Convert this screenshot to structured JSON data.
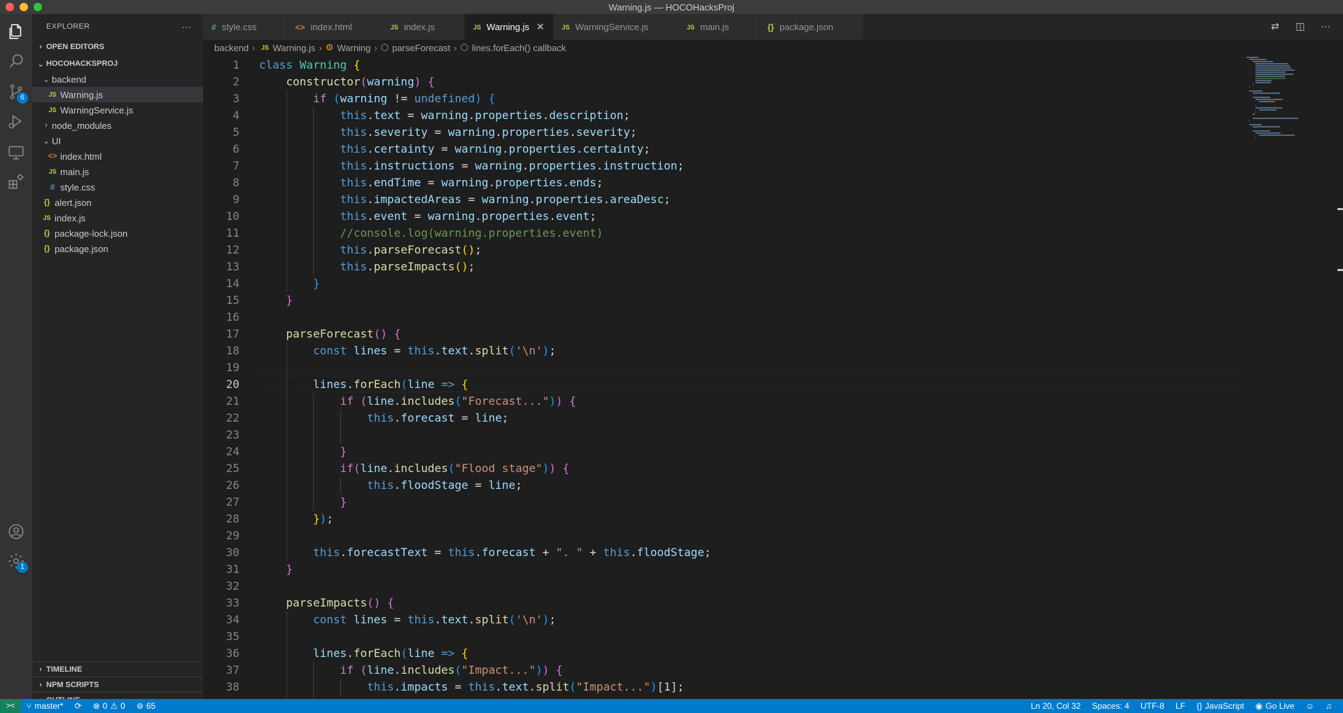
{
  "window": {
    "title": "Warning.js — HOCOHacksProj"
  },
  "colors": {
    "accent": "#007acc",
    "traffic_close": "#ff5f57",
    "traffic_min": "#febc2e",
    "traffic_max": "#28c840"
  },
  "activity": {
    "icons": [
      "files-icon",
      "search-icon",
      "source-control-icon",
      "run-debug-icon",
      "remote-explorer-icon",
      "extensions-icon",
      "account-icon",
      "settings-gear-icon"
    ],
    "scm_badge": "6",
    "settings_badge": "1"
  },
  "sidebar": {
    "title": "EXPLORER",
    "more": "···",
    "open_editors": "OPEN EDITORS",
    "project": "HOCOHACKSPROJ",
    "tree": [
      {
        "label": "backend",
        "type": "folder-open",
        "depth": 1
      },
      {
        "label": "Warning.js",
        "type": "js",
        "depth": 2,
        "selected": true
      },
      {
        "label": "WarningService.js",
        "type": "js",
        "depth": 2
      },
      {
        "label": "node_modules",
        "type": "folder-closed",
        "depth": 1
      },
      {
        "label": "UI",
        "type": "folder-open",
        "depth": 1
      },
      {
        "label": "index.html",
        "type": "html",
        "depth": 2
      },
      {
        "label": "main.js",
        "type": "js",
        "depth": 2
      },
      {
        "label": "style.css",
        "type": "css",
        "depth": 2
      },
      {
        "label": "alert.json",
        "type": "json",
        "depth": 1
      },
      {
        "label": "index.js",
        "type": "js",
        "depth": 1
      },
      {
        "label": "package-lock.json",
        "type": "json",
        "depth": 1
      },
      {
        "label": "package.json",
        "type": "json",
        "depth": 1
      }
    ],
    "timeline": "TIMELINE",
    "npm_scripts": "NPM SCRIPTS",
    "outline": "OUTLINE"
  },
  "tabs": [
    {
      "label": "style.css",
      "icon": "#",
      "type": "css"
    },
    {
      "label": "index.html",
      "icon": "<>",
      "type": "html"
    },
    {
      "label": "index.js",
      "icon": "JS",
      "type": "js"
    },
    {
      "label": "Warning.js",
      "icon": "JS",
      "type": "js",
      "active": true
    },
    {
      "label": "WarningService.js",
      "icon": "JS",
      "type": "js"
    },
    {
      "label": "main.js",
      "icon": "JS",
      "type": "js"
    },
    {
      "label": "package.json",
      "icon": "{}",
      "type": "json"
    }
  ],
  "breadcrumb": {
    "folder": "backend",
    "file": "Warning.js",
    "class": "Warning",
    "method": "parseForecast",
    "callback": "lines.forEach() callback"
  },
  "editor": {
    "current_line": 20,
    "lines": [
      [
        [
          "kw",
          "class"
        ],
        [
          "t",
          " "
        ],
        [
          "cls",
          "Warning"
        ],
        [
          "t",
          " "
        ],
        [
          "br1",
          "{"
        ]
      ],
      [
        [
          "t",
          "    "
        ],
        [
          "fn",
          "constructor"
        ],
        [
          "br2",
          "("
        ],
        [
          "var",
          "warning"
        ],
        [
          "br2",
          ")"
        ],
        [
          "t",
          " "
        ],
        [
          "br2",
          "{"
        ]
      ],
      [
        [
          "t",
          "        "
        ],
        [
          "ctl",
          "if"
        ],
        [
          "t",
          " "
        ],
        [
          "br3",
          "("
        ],
        [
          "var",
          "warning"
        ],
        [
          "t",
          " != "
        ],
        [
          "kw",
          "undefined"
        ],
        [
          "br3",
          ")"
        ],
        [
          "t",
          " "
        ],
        [
          "br3",
          "{"
        ]
      ],
      [
        [
          "t",
          "            "
        ],
        [
          "kw",
          "this"
        ],
        [
          "t",
          "."
        ],
        [
          "var",
          "text"
        ],
        [
          "t",
          " = "
        ],
        [
          "var",
          "warning"
        ],
        [
          "t",
          "."
        ],
        [
          "var",
          "properties"
        ],
        [
          "t",
          "."
        ],
        [
          "var",
          "description"
        ],
        [
          "t",
          ";"
        ]
      ],
      [
        [
          "t",
          "            "
        ],
        [
          "kw",
          "this"
        ],
        [
          "t",
          "."
        ],
        [
          "var",
          "severity"
        ],
        [
          "t",
          " = "
        ],
        [
          "var",
          "warning"
        ],
        [
          "t",
          "."
        ],
        [
          "var",
          "properties"
        ],
        [
          "t",
          "."
        ],
        [
          "var",
          "severity"
        ],
        [
          "t",
          ";"
        ]
      ],
      [
        [
          "t",
          "            "
        ],
        [
          "kw",
          "this"
        ],
        [
          "t",
          "."
        ],
        [
          "var",
          "certainty"
        ],
        [
          "t",
          " = "
        ],
        [
          "var",
          "warning"
        ],
        [
          "t",
          "."
        ],
        [
          "var",
          "properties"
        ],
        [
          "t",
          "."
        ],
        [
          "var",
          "certainty"
        ],
        [
          "t",
          ";"
        ]
      ],
      [
        [
          "t",
          "            "
        ],
        [
          "kw",
          "this"
        ],
        [
          "t",
          "."
        ],
        [
          "var",
          "instructions"
        ],
        [
          "t",
          " = "
        ],
        [
          "var",
          "warning"
        ],
        [
          "t",
          "."
        ],
        [
          "var",
          "properties"
        ],
        [
          "t",
          "."
        ],
        [
          "var",
          "instruction"
        ],
        [
          "t",
          ";"
        ]
      ],
      [
        [
          "t",
          "            "
        ],
        [
          "kw",
          "this"
        ],
        [
          "t",
          "."
        ],
        [
          "var",
          "endTime"
        ],
        [
          "t",
          " = "
        ],
        [
          "var",
          "warning"
        ],
        [
          "t",
          "."
        ],
        [
          "var",
          "properties"
        ],
        [
          "t",
          "."
        ],
        [
          "var",
          "ends"
        ],
        [
          "t",
          ";"
        ]
      ],
      [
        [
          "t",
          "            "
        ],
        [
          "kw",
          "this"
        ],
        [
          "t",
          "."
        ],
        [
          "var",
          "impactedAreas"
        ],
        [
          "t",
          " = "
        ],
        [
          "var",
          "warning"
        ],
        [
          "t",
          "."
        ],
        [
          "var",
          "properties"
        ],
        [
          "t",
          "."
        ],
        [
          "var",
          "areaDesc"
        ],
        [
          "t",
          ";"
        ]
      ],
      [
        [
          "t",
          "            "
        ],
        [
          "kw",
          "this"
        ],
        [
          "t",
          "."
        ],
        [
          "var",
          "event"
        ],
        [
          "t",
          " = "
        ],
        [
          "var",
          "warning"
        ],
        [
          "t",
          "."
        ],
        [
          "var",
          "properties"
        ],
        [
          "t",
          "."
        ],
        [
          "var",
          "event"
        ],
        [
          "t",
          ";"
        ]
      ],
      [
        [
          "t",
          "            "
        ],
        [
          "cmt",
          "//console.log(warning.properties.event)"
        ]
      ],
      [
        [
          "t",
          "            "
        ],
        [
          "kw",
          "this"
        ],
        [
          "t",
          "."
        ],
        [
          "fn",
          "parseForecast"
        ],
        [
          "br1",
          "("
        ],
        [
          "br1",
          ")"
        ],
        [
          "t",
          ";"
        ]
      ],
      [
        [
          "t",
          "            "
        ],
        [
          "kw",
          "this"
        ],
        [
          "t",
          "."
        ],
        [
          "fn",
          "parseImpacts"
        ],
        [
          "br1",
          "("
        ],
        [
          "br1",
          ")"
        ],
        [
          "t",
          ";"
        ]
      ],
      [
        [
          "t",
          "        "
        ],
        [
          "br3",
          "}"
        ]
      ],
      [
        [
          "t",
          "    "
        ],
        [
          "br2",
          "}"
        ]
      ],
      [
        [
          "t",
          ""
        ]
      ],
      [
        [
          "t",
          "    "
        ],
        [
          "fn",
          "parseForecast"
        ],
        [
          "br2",
          "("
        ],
        [
          "br2",
          ")"
        ],
        [
          "t",
          " "
        ],
        [
          "br2",
          "{"
        ]
      ],
      [
        [
          "t",
          "        "
        ],
        [
          "kw",
          "const"
        ],
        [
          "t",
          " "
        ],
        [
          "var",
          "lines"
        ],
        [
          "t",
          " = "
        ],
        [
          "kw",
          "this"
        ],
        [
          "t",
          "."
        ],
        [
          "var",
          "text"
        ],
        [
          "t",
          "."
        ],
        [
          "fn",
          "split"
        ],
        [
          "br3",
          "("
        ],
        [
          "str",
          "'\\n'"
        ],
        [
          "br3",
          ")"
        ],
        [
          "t",
          ";"
        ]
      ],
      [
        [
          "t",
          ""
        ]
      ],
      [
        [
          "t",
          "        "
        ],
        [
          "var",
          "lines"
        ],
        [
          "t",
          "."
        ],
        [
          "fn",
          "forEach"
        ],
        [
          "br3",
          "("
        ],
        [
          "var",
          "line"
        ],
        [
          "t",
          " "
        ],
        [
          "kw",
          "=>"
        ],
        [
          "t",
          " "
        ],
        [
          "br1",
          "{"
        ]
      ],
      [
        [
          "t",
          "            "
        ],
        [
          "ctl",
          "if"
        ],
        [
          "t",
          " "
        ],
        [
          "br2",
          "("
        ],
        [
          "var",
          "line"
        ],
        [
          "t",
          "."
        ],
        [
          "fn",
          "includes"
        ],
        [
          "br3",
          "("
        ],
        [
          "str",
          "\"Forecast...\""
        ],
        [
          "br3",
          ")"
        ],
        [
          "br2",
          ")"
        ],
        [
          "t",
          " "
        ],
        [
          "br2",
          "{"
        ]
      ],
      [
        [
          "t",
          "                "
        ],
        [
          "kw",
          "this"
        ],
        [
          "t",
          "."
        ],
        [
          "var",
          "forecast"
        ],
        [
          "t",
          " = "
        ],
        [
          "var",
          "line"
        ],
        [
          "t",
          ";"
        ]
      ],
      [
        [
          "t",
          ""
        ]
      ],
      [
        [
          "t",
          "            "
        ],
        [
          "br2",
          "}"
        ]
      ],
      [
        [
          "t",
          "            "
        ],
        [
          "ctl",
          "if"
        ],
        [
          "br2",
          "("
        ],
        [
          "var",
          "line"
        ],
        [
          "t",
          "."
        ],
        [
          "fn",
          "includes"
        ],
        [
          "br3",
          "("
        ],
        [
          "str",
          "\"Flood stage\""
        ],
        [
          "br3",
          ")"
        ],
        [
          "br2",
          ")"
        ],
        [
          "t",
          " "
        ],
        [
          "br2",
          "{"
        ]
      ],
      [
        [
          "t",
          "                "
        ],
        [
          "kw",
          "this"
        ],
        [
          "t",
          "."
        ],
        [
          "var",
          "floodStage"
        ],
        [
          "t",
          " = "
        ],
        [
          "var",
          "line"
        ],
        [
          "t",
          ";"
        ]
      ],
      [
        [
          "t",
          "            "
        ],
        [
          "br2",
          "}"
        ]
      ],
      [
        [
          "t",
          "        "
        ],
        [
          "br1",
          "}"
        ],
        [
          "br3",
          ")"
        ],
        [
          "t",
          ";"
        ]
      ],
      [
        [
          "t",
          ""
        ]
      ],
      [
        [
          "t",
          "        "
        ],
        [
          "kw",
          "this"
        ],
        [
          "t",
          "."
        ],
        [
          "var",
          "forecastText"
        ],
        [
          "t",
          " = "
        ],
        [
          "kw",
          "this"
        ],
        [
          "t",
          "."
        ],
        [
          "var",
          "forecast"
        ],
        [
          "t",
          " + "
        ],
        [
          "str",
          "\". \""
        ],
        [
          "t",
          " + "
        ],
        [
          "kw",
          "this"
        ],
        [
          "t",
          "."
        ],
        [
          "var",
          "floodStage"
        ],
        [
          "t",
          ";"
        ]
      ],
      [
        [
          "t",
          "    "
        ],
        [
          "br2",
          "}"
        ]
      ],
      [
        [
          "t",
          ""
        ]
      ],
      [
        [
          "t",
          "    "
        ],
        [
          "fn",
          "parseImpacts"
        ],
        [
          "br2",
          "("
        ],
        [
          "br2",
          ")"
        ],
        [
          "t",
          " "
        ],
        [
          "br2",
          "{"
        ]
      ],
      [
        [
          "t",
          "        "
        ],
        [
          "kw",
          "const"
        ],
        [
          "t",
          " "
        ],
        [
          "var",
          "lines"
        ],
        [
          "t",
          " = "
        ],
        [
          "kw",
          "this"
        ],
        [
          "t",
          "."
        ],
        [
          "var",
          "text"
        ],
        [
          "t",
          "."
        ],
        [
          "fn",
          "split"
        ],
        [
          "br3",
          "("
        ],
        [
          "str",
          "'\\n'"
        ],
        [
          "br3",
          ")"
        ],
        [
          "t",
          ";"
        ]
      ],
      [
        [
          "t",
          ""
        ]
      ],
      [
        [
          "t",
          "        "
        ],
        [
          "var",
          "lines"
        ],
        [
          "t",
          "."
        ],
        [
          "fn",
          "forEach"
        ],
        [
          "br3",
          "("
        ],
        [
          "var",
          "line"
        ],
        [
          "t",
          " "
        ],
        [
          "kw",
          "=>"
        ],
        [
          "t",
          " "
        ],
        [
          "br1",
          "{"
        ]
      ],
      [
        [
          "t",
          "            "
        ],
        [
          "ctl",
          "if"
        ],
        [
          "t",
          " "
        ],
        [
          "br2",
          "("
        ],
        [
          "var",
          "line"
        ],
        [
          "t",
          "."
        ],
        [
          "fn",
          "includes"
        ],
        [
          "br3",
          "("
        ],
        [
          "str",
          "\"Impact...\""
        ],
        [
          "br3",
          ")"
        ],
        [
          "br2",
          ")"
        ],
        [
          "t",
          " "
        ],
        [
          "br2",
          "{"
        ]
      ],
      [
        [
          "t",
          "                "
        ],
        [
          "kw",
          "this"
        ],
        [
          "t",
          "."
        ],
        [
          "var",
          "impacts"
        ],
        [
          "t",
          " = "
        ],
        [
          "kw",
          "this"
        ],
        [
          "t",
          "."
        ],
        [
          "var",
          "text"
        ],
        [
          "t",
          "."
        ],
        [
          "fn",
          "split"
        ],
        [
          "br3",
          "("
        ],
        [
          "str",
          "\"Impact...\""
        ],
        [
          "br3",
          ")"
        ],
        [
          "t",
          "[1];"
        ]
      ],
      [
        [
          "t",
          "            "
        ],
        [
          "br2",
          "}"
        ]
      ]
    ]
  },
  "statusbar": {
    "remote": "><",
    "branch": "master*",
    "sync": "⟳",
    "errors": "0",
    "warnings": "0",
    "ports": "65",
    "position": "Ln 20, Col 32",
    "spaces": "Spaces: 4",
    "encoding": "UTF-8",
    "eol": "LF",
    "language": "JavaScript",
    "golive": "Go Live"
  }
}
